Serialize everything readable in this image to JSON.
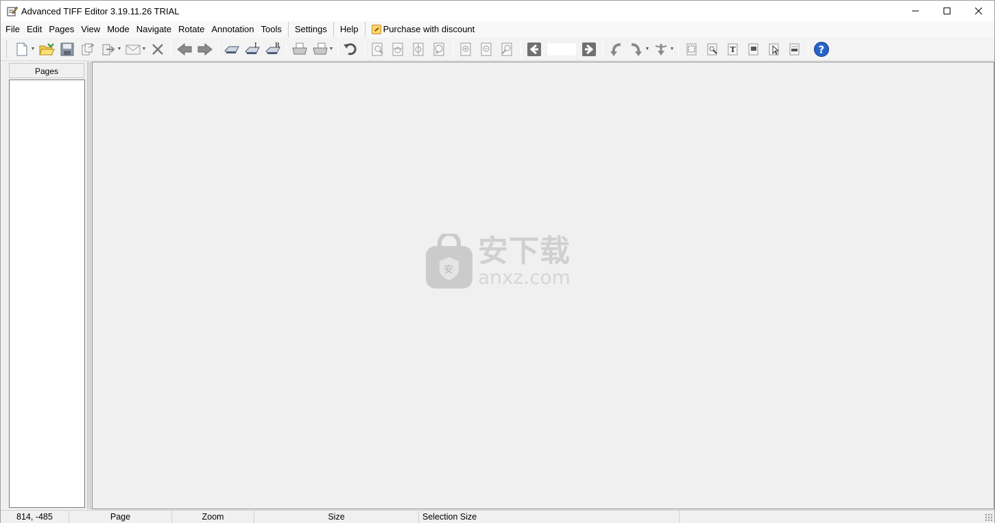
{
  "window": {
    "title": "Advanced TIFF Editor 3.19.11.26 TRIAL",
    "controls": {
      "minimize": "minimize-icon",
      "maximize": "maximize-icon",
      "close": "close-icon"
    }
  },
  "menu": {
    "items": [
      "File",
      "Edit",
      "Pages",
      "View",
      "Mode",
      "Navigate",
      "Rotate",
      "Annotation",
      "Tools"
    ],
    "settings": "Settings",
    "help": "Help",
    "purchase": "Purchase with discount"
  },
  "toolbar": {
    "page_number": "",
    "icons": [
      "new-icon",
      "open-folder-icon",
      "save-icon",
      "save-all-icon",
      "export-icon",
      "email-icon",
      "close-doc-icon",
      "previous-page-icon",
      "next-page-icon",
      "scan-icon",
      "scan-insert-icon",
      "scan-replace-icon",
      "print-icon",
      "print-options-icon",
      "undo-icon",
      "zoom-fit-icon",
      "zoom-width-icon",
      "zoom-height-icon",
      "zoom-actual-icon",
      "zoom-in-icon",
      "zoom-out-icon",
      "zoom-custom-icon",
      "go-back-icon",
      "go-forward-icon",
      "rotate-left-icon",
      "rotate-right-icon",
      "flip-icon",
      "select-icon",
      "magnify-icon",
      "text-tool-icon",
      "stamp-icon",
      "pointer-icon",
      "properties-icon",
      "help-icon"
    ]
  },
  "left_panel": {
    "header": "Pages"
  },
  "workspace": {
    "watermark_cn": "安下载",
    "watermark_en": "anxz.com"
  },
  "status": {
    "coords": "814, -485",
    "page": "Page",
    "zoom": "Zoom",
    "size": "Size",
    "selection": "Selection Size"
  }
}
